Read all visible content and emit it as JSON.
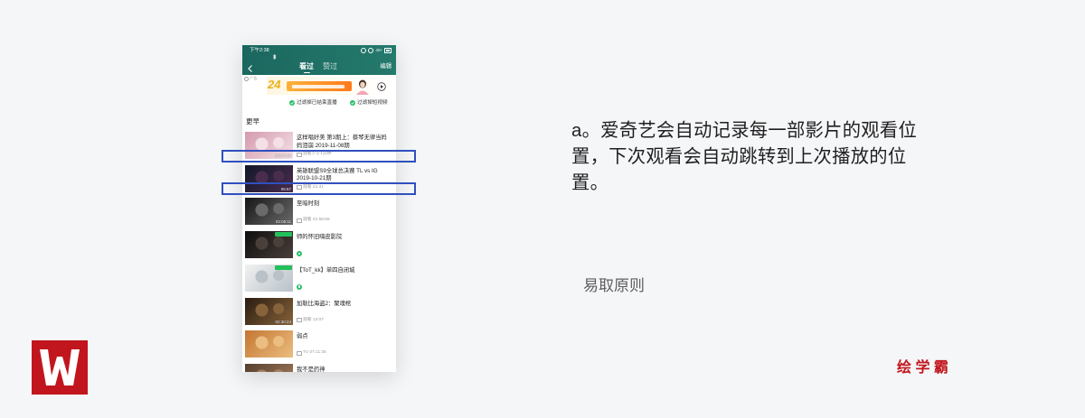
{
  "phone": {
    "status_bar": {
      "time": "下午2:38",
      "network": "40+"
    },
    "nav": {
      "tabs": [
        "看过",
        "赞过"
      ],
      "edit": "编辑"
    },
    "ad": {
      "label": "广告",
      "badge": "24"
    },
    "filters": [
      "过滤掉已结束直播",
      "过滤掉短视频"
    ],
    "section_title": "更早",
    "items": [
      {
        "title": "这样唱好美 第3期上：蔡琴无律当妈妈泪崩 2019-11-08期",
        "meta": "观看少于1分钟",
        "duration": "00:47:08",
        "live": false,
        "thumb_colors": [
          "#d49aae",
          "#f4e0e6"
        ]
      },
      {
        "title": "英雄联盟S9全球总决赛 TL vs IG 2019-10-21期",
        "meta": "观看 21:41",
        "duration": "05:57",
        "live": false,
        "thumb_colors": [
          "#121829",
          "#4a2c4f"
        ]
      },
      {
        "title": "至暗时刻",
        "meta": "观看 01:58:59",
        "duration": "02:05:11",
        "live": false,
        "thumb_colors": [
          "#161616",
          "#6a6a6a"
        ]
      },
      {
        "title": "师的怀旧嗨皮影院",
        "meta": "",
        "duration": "",
        "live": true,
        "thumb_colors": [
          "#0e0e0e",
          "#4a3f3a"
        ]
      },
      {
        "title": "【ToT_kk】单四自闭城",
        "meta": "",
        "duration": "",
        "live": true,
        "thumb_colors": [
          "#f1f1f1",
          "#b9c2c9"
        ]
      },
      {
        "title": "加勒比海盗2：聚魂棺",
        "meta": "观看 13:07",
        "duration": "02:30:24",
        "live": false,
        "thumb_colors": [
          "#2a1c10",
          "#86633b"
        ]
      },
      {
        "title": "弱点",
        "meta": "TV 07:11:35",
        "duration": "",
        "live": false,
        "thumb_colors": [
          "#c47631",
          "#ebbd80"
        ]
      },
      {
        "title": "我不是药神",
        "meta": "",
        "duration": "",
        "live": false,
        "thumb_colors": [
          "#563f2f",
          "#a67e5c"
        ]
      }
    ]
  },
  "description": {
    "lines": [
      "a。爱奇艺会自动记录每一部影片的观看位",
      "置，下次观看会自动跳转到上次播放的位",
      "置。"
    ]
  },
  "principle": "易取原则",
  "brand": "绘 学 霸",
  "colors": {
    "header_start": "#1b675f",
    "header_end": "#247a6c",
    "highlight": "#3050bf",
    "brand_red": "#c1161d",
    "check_green": "#2bbf6a",
    "live_green": "#22c05a"
  }
}
